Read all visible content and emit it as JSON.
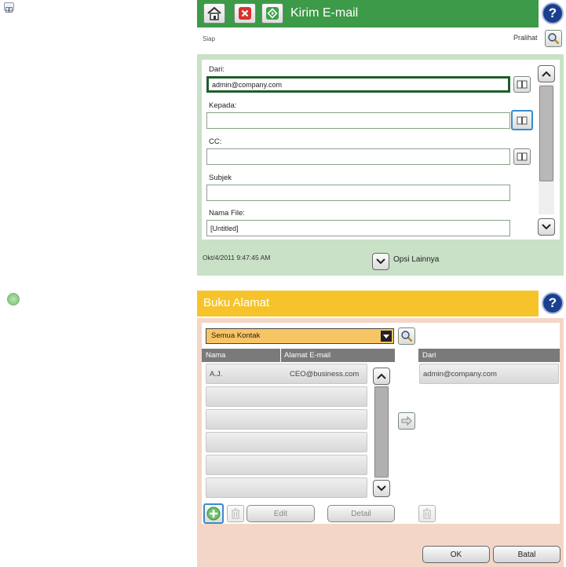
{
  "send_email": {
    "title": "Kirim E-mail",
    "status": "Siap",
    "preview_label": "Pralihat",
    "from_label": "Dari:",
    "from_value": "admin@company.com",
    "to_label": "Kepada:",
    "to_value": "",
    "cc_label": "CC:",
    "cc_value": "",
    "subject_label": "Subjek",
    "subject_value": "",
    "filename_label": "Nama File:",
    "filename_value": "[Untitled]",
    "timestamp": "Okt/4/2011 9:47:45 AM",
    "more_options_label": "Opsi Lainnya"
  },
  "address_book": {
    "title": "Buku Alamat",
    "filter_value": "Semua Kontak",
    "col_name": "Nama",
    "col_email": "Alamat E-mail",
    "col_from": "Dari",
    "contacts": [
      {
        "name": "A.J.",
        "email": "CEO@business.com"
      }
    ],
    "from_entries": [
      "admin@company.com"
    ],
    "edit_label": "Edit",
    "detail_label": "Detail",
    "ok_label": "OK",
    "cancel_label": "Batal"
  },
  "colors": {
    "green_header": "#3c9a48",
    "yellow_header": "#f6c42a",
    "green_panel": "#c9e1c7",
    "peach_panel": "#f3d6c8",
    "help_blue": "#1b3f8f"
  },
  "icons": [
    "address-book-icon",
    "add-contact-icon",
    "home-icon",
    "stop-icon",
    "start-icon",
    "help-icon",
    "magnifier-icon",
    "trash-icon",
    "arrow-right-icon",
    "chevron-up-icon",
    "chevron-down-icon"
  ]
}
